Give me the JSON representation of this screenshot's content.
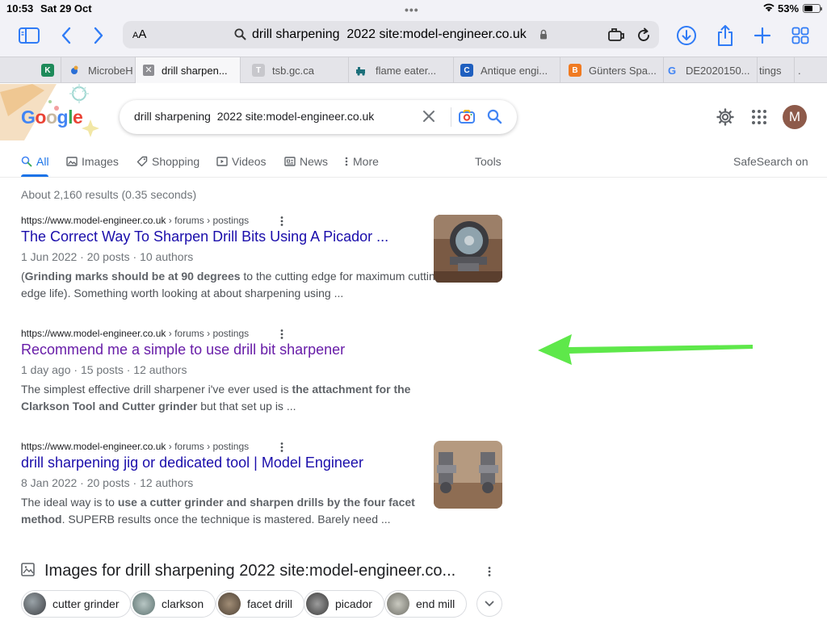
{
  "status_bar": {
    "time": "10:53",
    "date": "Sat 29 Oct",
    "battery_percent": "53%",
    "battery_level": 0.53
  },
  "toolbar": {
    "text_size_label": "AA",
    "url": "drill sharpening  2022 site:model-engineer.co.uk",
    "icons": [
      "sidebar-icon",
      "back-icon",
      "forward-icon",
      "download-icon",
      "share-icon",
      "new-tab-icon",
      "tab-overview-icon"
    ],
    "accent_color": "#2f7bf6"
  },
  "tabs": [
    {
      "label": "",
      "favicon": "K"
    },
    {
      "label": "MicrobeH",
      "favicon": "microbe"
    },
    {
      "label": "drill sharpen...",
      "favicon": "close",
      "active": true
    },
    {
      "label": "tsb.gc.ca",
      "favicon": "T"
    },
    {
      "label": "flame eater...",
      "favicon": "train"
    },
    {
      "label": "Antique engi...",
      "favicon": "C"
    },
    {
      "label": "Günters Spa...",
      "favicon": "blogger"
    },
    {
      "label": "DE2020150...",
      "favicon": "G"
    },
    {
      "label": "tings",
      "favicon": ""
    },
    {
      "label": ".",
      "favicon": ""
    }
  ],
  "google": {
    "logo_text": "Google",
    "search_query": "drill sharpening  2022 site:model-engineer.co.uk",
    "avatar_initial": "M",
    "nav": {
      "all": "All",
      "images": "Images",
      "shopping": "Shopping",
      "videos": "Videos",
      "news": "News",
      "more": "More",
      "tools": "Tools",
      "safesearch": "SafeSearch on"
    },
    "stats": "About 2,160 results (0.35 seconds)"
  },
  "results": [
    {
      "site": "https://www.model-engineer.co.uk",
      "breadcrumb": " › forums › postings",
      "title": "The Correct Way To Sharpen Drill Bits Using A Picador ...",
      "meta": "1 Jun 2022 · 20 posts · 10 authors",
      "snippet_pre": "(",
      "snippet_bold": "Grinding marks should be at 90 degrees",
      "snippet_post": " to the cutting edge for maximum cutting edge life). Something worth looking at about sharpening using ...",
      "visited": false
    },
    {
      "site": "https://www.model-engineer.co.uk",
      "breadcrumb": " › forums › postings",
      "title": "Recommend me a simple to use drill bit sharpener",
      "meta": "1 day ago · 15 posts · 12 authors",
      "snippet_pre": "The simplest effective drill sharpener i've ever used is ",
      "snippet_bold": "the attachment for the Clarkson Tool and Cutter grinder",
      "snippet_post": " but that set up is ...",
      "visited": true
    },
    {
      "site": "https://www.model-engineer.co.uk",
      "breadcrumb": " › forums › postings",
      "title": "drill sharpening jig or dedicated tool | Model Engineer",
      "meta": "8 Jan 2022 · 20 posts · 12 authors",
      "snippet_pre": "The ideal way is to ",
      "snippet_bold": "use a cutter grinder and sharpen drills by the four facet method",
      "snippet_post": ". SUPERB results once the technique is mastered. Barely need ...",
      "visited": false
    }
  ],
  "images_block": {
    "title": "Images for drill sharpening 2022 site:model-engineer.co...",
    "chips": [
      "cutter grinder",
      "clarkson",
      "facet drill",
      "picador",
      "end mill"
    ]
  },
  "colors": {
    "link": "#1a0dab",
    "visited": "#681da8",
    "google_blue": "#1a73e8",
    "annotation_arrow": "#5ee84a"
  }
}
